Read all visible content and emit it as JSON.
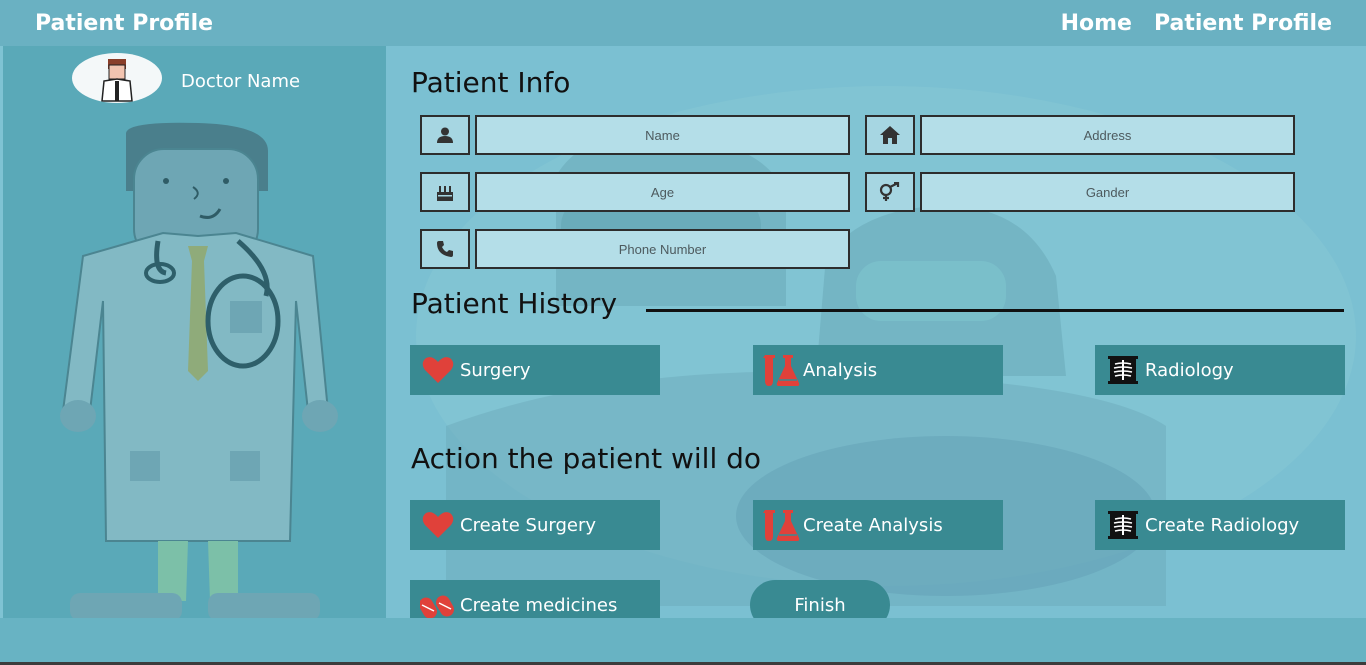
{
  "header": {
    "brand": "Patient Profile",
    "nav": [
      "Home",
      "Patient Profile"
    ]
  },
  "sidebar": {
    "doctor_name": "Doctor Name"
  },
  "patient_info": {
    "title": "Patient Info",
    "fields": {
      "name": {
        "placeholder": "Name",
        "icon": "person-icon"
      },
      "address": {
        "placeholder": "Address",
        "icon": "home-icon"
      },
      "age": {
        "placeholder": "Age",
        "icon": "birthday-cake-icon"
      },
      "gender": {
        "placeholder": "Gander",
        "icon": "gender-icon"
      },
      "phone": {
        "placeholder": "Phone Number",
        "icon": "phone-icon"
      }
    }
  },
  "history": {
    "title": "Patient History",
    "buttons": {
      "surgery": "Surgery",
      "analysis": "Analysis",
      "radiology": "Radiology"
    }
  },
  "actions": {
    "title": "Action the patient will do",
    "buttons": {
      "create_surgery": "Create Surgery",
      "create_analysis": "Create Analysis",
      "create_radiology": "Create Radiology",
      "create_medicines": "Create medicines",
      "finish": "Finish"
    }
  },
  "colors": {
    "accent_button": "#398a92",
    "header": "#6ab1c2",
    "heart_red": "#e0413a"
  }
}
